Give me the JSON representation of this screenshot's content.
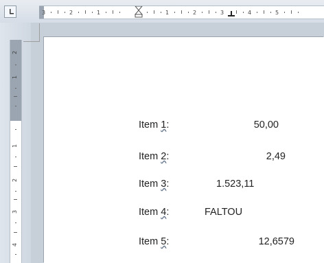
{
  "ruler": {
    "horizontal_labels": [
      "3",
      "2",
      "1",
      "1",
      "2",
      "3",
      "4",
      "5"
    ],
    "vertical_labels": [
      "2",
      "1",
      "1",
      "2",
      "3",
      "4"
    ]
  },
  "document": {
    "items": [
      {
        "label_prefix": "Item ",
        "label_number": "1",
        "label_suffix": ":",
        "value": "50,00"
      },
      {
        "label_prefix": "Item ",
        "label_number": "2",
        "label_suffix": ":",
        "value": "2,49"
      },
      {
        "label_prefix": "Item ",
        "label_number": "3",
        "label_suffix": ":",
        "value": "1.523,11"
      },
      {
        "label_prefix": "Item ",
        "label_number": "4",
        "label_suffix": ":",
        "value": "FALTOU"
      },
      {
        "label_prefix": "Item ",
        "label_number": "5",
        "label_suffix": ":",
        "value": "12,6579"
      }
    ]
  }
}
